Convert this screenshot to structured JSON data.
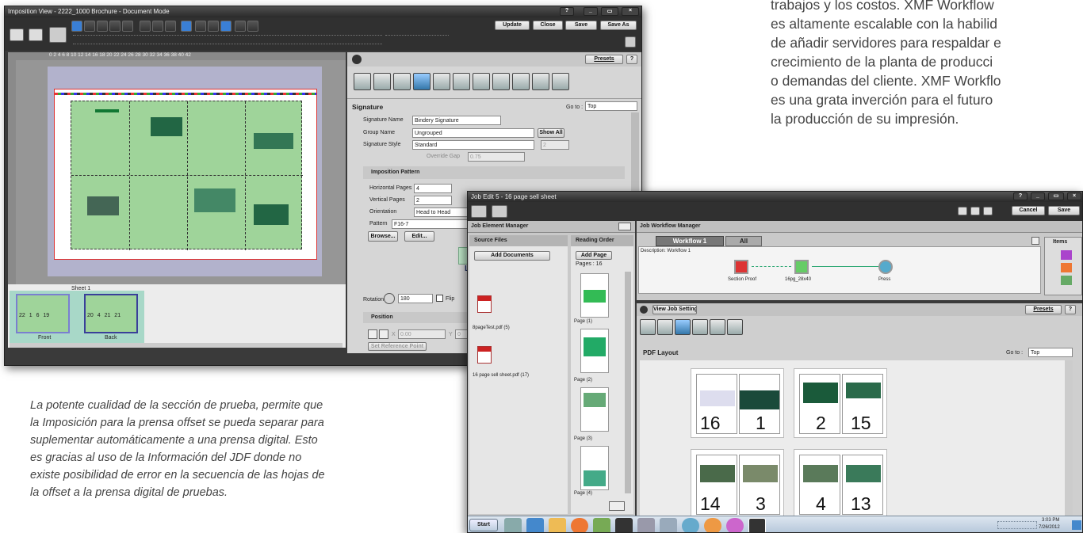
{
  "background_text": {
    "lines": [
      "trabajos y los costos. XMF Workflow",
      "es altamente escalable con la habilid",
      "de añadir servidores para respaldar e",
      "crecimiento de la planta de producci",
      "o demandas del cliente. XMF Workflo",
      "es una grata inverción para el futuro",
      "la producción de su impresión."
    ]
  },
  "caption": {
    "lines": [
      "La potente cualidad de la sección de prueba, permite que",
      "la Imposición para la prensa offset se pueda separar para",
      "suplementar automáticamente a una prensa digital. Esto",
      "es gracias al uso de la Información del JDF donde no",
      "existe posibilidad de error en la secuencia de las hojas  de",
      "la offset a la prensa digital de pruebas."
    ]
  },
  "win1": {
    "title": "Imposition View - 2222_1000 Brochure - Document Mode",
    "controls": [
      "?",
      "_",
      "▭",
      "×"
    ],
    "buttons": {
      "update": "Update",
      "close": "Close",
      "save": "Save",
      "save_as": "Save As"
    },
    "ruler": "0  2  4  6  8  10 12 14 16 18 20 22 24 26 28 30 32 34 36 38 40 42",
    "sheet_label": "Sheet 1",
    "front_label": "Front",
    "back_label": "Back",
    "front_nums": "22 1 6 19",
    "back_nums": "20 4 21 21",
    "presets": "Presets",
    "help": "?",
    "signature": {
      "header": "Signature",
      "goto_label": "Go to :",
      "goto_value": "Top",
      "name_label": "Signature Name",
      "name_value": "Bindery Signature",
      "group_label": "Group Name",
      "group_value": "Ungrouped",
      "show_all": "Show All",
      "style_label": "Signature Style",
      "style_value": "Standard",
      "style_num": "2",
      "override_label": "Override Gap",
      "override_value": "0.75"
    },
    "imposition": {
      "header": "Imposition Pattern",
      "hpages_label": "Horizontal Pages",
      "hpages_value": "4",
      "vpages_label": "Vertical Pages",
      "vpages_value": "2",
      "orient_label": "Orientation",
      "orient_value": "Head to Head",
      "pattern_label": "Pattern",
      "pattern_value": "F16-7",
      "browse": "Browse...",
      "edit": "Edit...",
      "partial": "L"
    },
    "rotation": {
      "label": "Rotation",
      "value": "180",
      "flip": "Flip"
    },
    "position": {
      "header": "Position",
      "x_label": "X",
      "x_value": "0.00",
      "y_label": "Y",
      "y_value": "0",
      "set_ref": "Set Reference Point"
    }
  },
  "win2": {
    "title": "Job Edit 5 - 16 page sell sheet",
    "controls": [
      "?",
      "_",
      "▭",
      "×"
    ],
    "cancel": "Cancel",
    "save": "Save",
    "jem": {
      "title": "Job Element Manager",
      "source_files": "Source Files",
      "reading_order": "Reading Order",
      "add_documents": "Add Documents",
      "add_page": "Add Page",
      "pages": "Pages : 16",
      "files": [
        "8pageTest.pdf (5)",
        "16 page sell sheet.pdf (17)"
      ],
      "page_labels": [
        "Page (1)",
        "Page (2)",
        "Page (3)",
        "Page (4)"
      ]
    },
    "jwm": {
      "title": "Job Workflow Manager",
      "tabs": [
        "Workflow 1",
        "All"
      ],
      "description": "Description:  Workflow 1",
      "nodes": [
        "Section Proof",
        "16pg_28x40",
        "Press"
      ],
      "items": "Items"
    },
    "settings": {
      "view_job_settings": "View Job Settings",
      "presets": "Presets",
      "help": "?",
      "pdf_layout": "PDF Layout",
      "goto_label": "Go to :",
      "goto_value": "Top",
      "spreads": [
        [
          "16",
          "1"
        ],
        [
          "2",
          "15"
        ],
        [
          "14",
          "3"
        ],
        [
          "4",
          "13"
        ]
      ]
    },
    "taskbar": {
      "start": "Start",
      "time": "3:03 PM",
      "date": "7/26/2012"
    }
  }
}
